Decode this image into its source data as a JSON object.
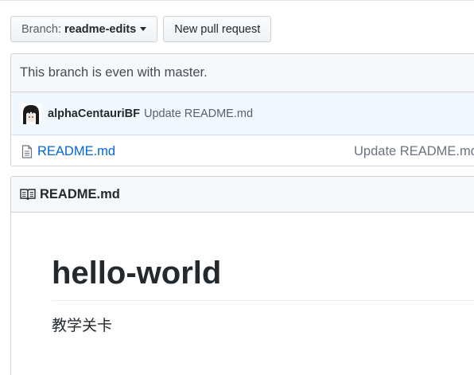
{
  "toolbar": {
    "branch_label": "Branch:",
    "branch_name": "readme-edits",
    "new_pr_label": "New pull request"
  },
  "branch_status": "This branch is even with master.",
  "commit": {
    "author": "alphaCentauriBF",
    "message": "Update README.md"
  },
  "files": [
    {
      "name": "README.md",
      "last_commit": "Update README.md"
    }
  ],
  "readme": {
    "header_title": "README.md",
    "heading": "hello-world",
    "paragraph": "教学关卡"
  },
  "icons": {
    "branch_caret": "caret-down-icon",
    "file": "file-icon",
    "book": "book-icon"
  },
  "colors": {
    "link": "#0366d6",
    "commit_bar_bg": "#f1f8ff",
    "header_bg": "#f6f8fa"
  }
}
